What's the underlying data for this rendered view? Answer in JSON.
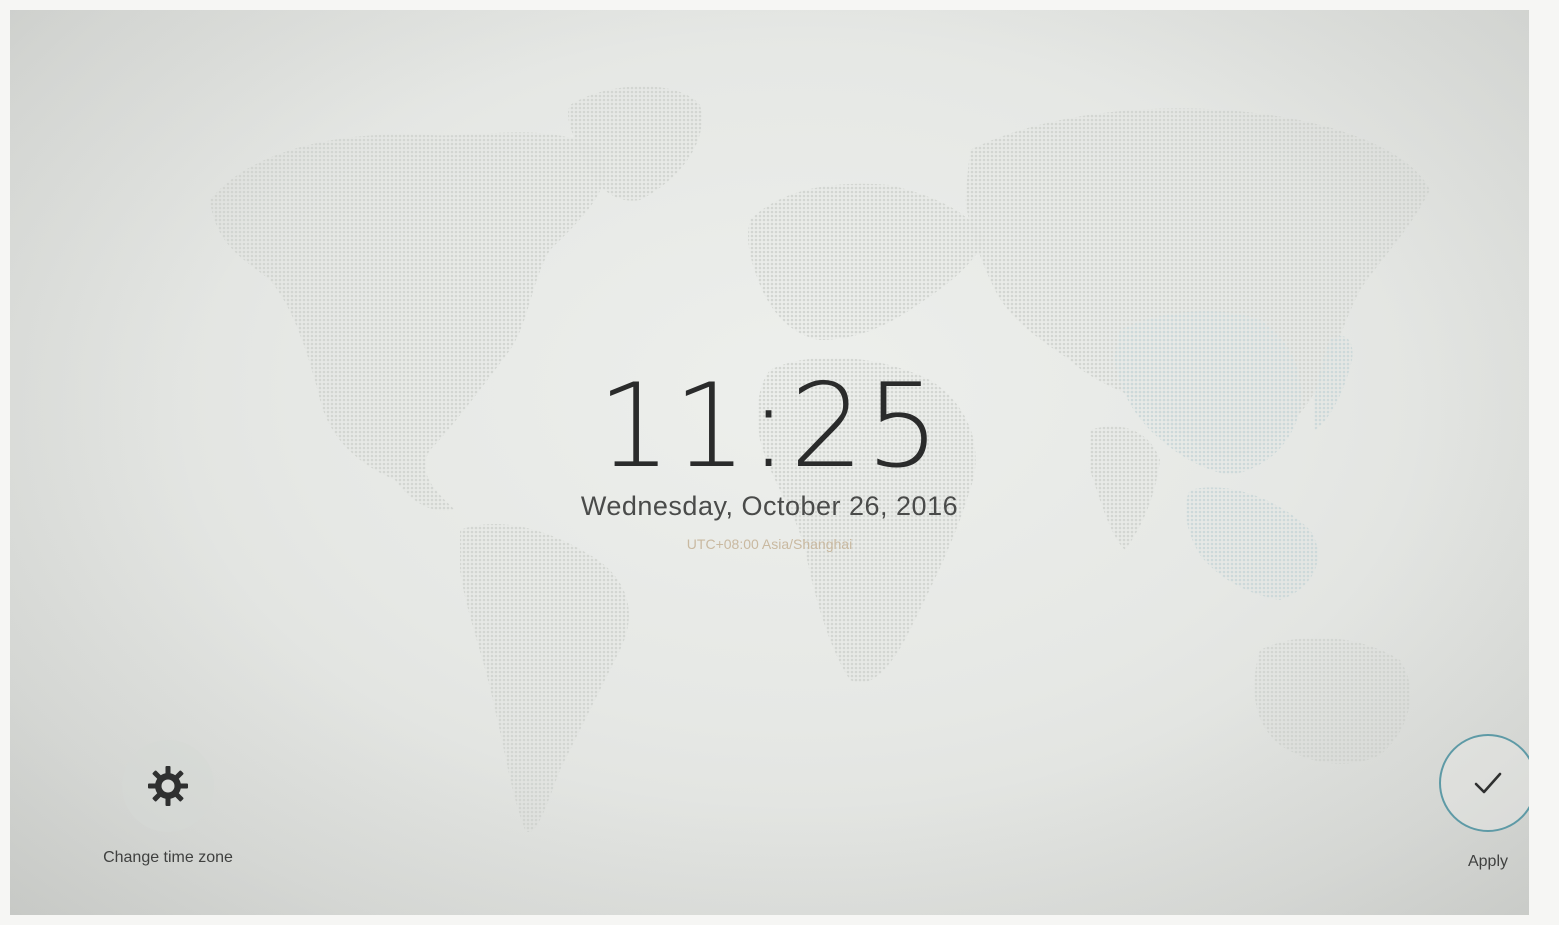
{
  "clock": {
    "time": "11:25",
    "date": "Wednesday, October 26, 2016",
    "timezone": "UTC+08:00 Asia/Shanghai"
  },
  "actions": {
    "change_time_zone": {
      "label": "Change time zone",
      "icon": "gear-icon"
    },
    "apply": {
      "label": "Apply",
      "icon": "checkmark-icon"
    }
  },
  "colors": {
    "apply_ring": "#5e9aa6",
    "timezone_text": "#c9b9a0",
    "clock_text": "#2a2b2b"
  }
}
